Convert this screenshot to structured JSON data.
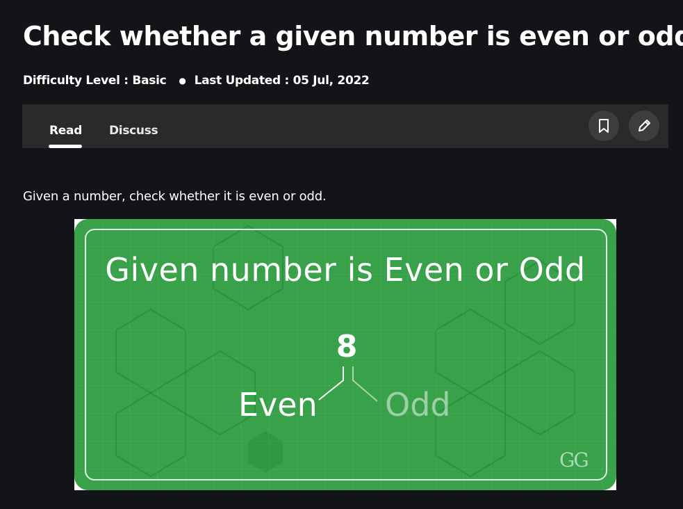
{
  "article": {
    "title": "Check whether a given number is even or odd",
    "difficulty": "Difficulty Level : Basic",
    "updated": "Last Updated : 05 Jul, 2022",
    "intro": "Given a number, check whether it is even or odd."
  },
  "tabs": {
    "read": "Read",
    "discuss": "Discuss",
    "active": "Read"
  },
  "actions": {
    "bookmark_icon": "bookmark-icon",
    "edit_icon": "pencil-icon"
  },
  "figure": {
    "heading": "Given number is Even or Odd",
    "number": "8",
    "even_label": "Even",
    "odd_label": "Odd",
    "logo": "GG",
    "background_color": "#38a149"
  },
  "colors": {
    "page_background": "#131417",
    "tab_bar": "#2a2a2b",
    "icon_button": "#3d3d3e"
  }
}
